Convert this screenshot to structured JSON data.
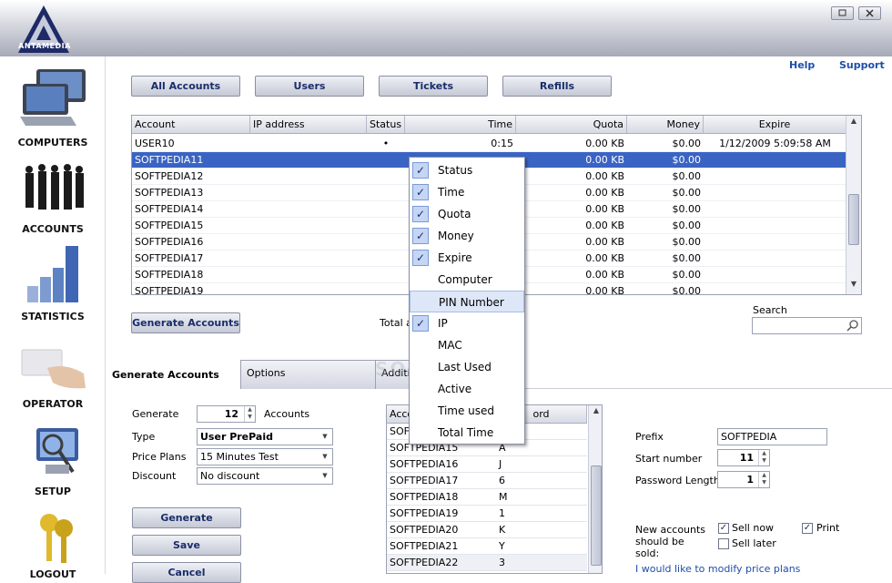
{
  "app": {
    "logo_text": "ANTAMEDIA"
  },
  "links": {
    "help": "Help",
    "support": "Support"
  },
  "sidebar": [
    {
      "name": "computers",
      "label": "COMPUTERS"
    },
    {
      "name": "accounts",
      "label": "ACCOUNTS"
    },
    {
      "name": "statistics",
      "label": "STATISTICS"
    },
    {
      "name": "operator",
      "label": "OPERATOR"
    },
    {
      "name": "setup",
      "label": "SETUP"
    },
    {
      "name": "logout",
      "label": "LOGOUT"
    }
  ],
  "top_tabs": [
    "All Accounts",
    "Users",
    "Tickets",
    "Refills"
  ],
  "grid": {
    "columns": [
      "Account",
      "IP address",
      "Status",
      "Time",
      "Quota",
      "Money",
      "Expire"
    ],
    "rows": [
      {
        "account": "USER10",
        "ip": "",
        "status": "•",
        "time": "0:15",
        "quota": "0.00 KB",
        "money": "$0.00",
        "expire": "1/12/2009 5:09:58 AM"
      },
      {
        "account": "SOFTPEDIA11",
        "ip": "",
        "status": "",
        "time": "",
        "quota": "0.00 KB",
        "money": "$0.00",
        "expire": ""
      },
      {
        "account": "SOFTPEDIA12",
        "ip": "",
        "status": "",
        "time": "",
        "quota": "0.00 KB",
        "money": "$0.00",
        "expire": ""
      },
      {
        "account": "SOFTPEDIA13",
        "ip": "",
        "status": "",
        "time": "",
        "quota": "0.00 KB",
        "money": "$0.00",
        "expire": ""
      },
      {
        "account": "SOFTPEDIA14",
        "ip": "",
        "status": "",
        "time": "",
        "quota": "0.00 KB",
        "money": "$0.00",
        "expire": ""
      },
      {
        "account": "SOFTPEDIA15",
        "ip": "",
        "status": "",
        "time": "",
        "quota": "0.00 KB",
        "money": "$0.00",
        "expire": ""
      },
      {
        "account": "SOFTPEDIA16",
        "ip": "",
        "status": "",
        "time": "",
        "quota": "0.00 KB",
        "money": "$0.00",
        "expire": ""
      },
      {
        "account": "SOFTPEDIA17",
        "ip": "",
        "status": "",
        "time": "",
        "quota": "0.00 KB",
        "money": "$0.00",
        "expire": ""
      },
      {
        "account": "SOFTPEDIA18",
        "ip": "",
        "status": "",
        "time": "",
        "quota": "0.00 KB",
        "money": "$0.00",
        "expire": ""
      },
      {
        "account": "SOFTPEDIA19",
        "ip": "",
        "status": "",
        "time": "",
        "quota": "0.00 KB",
        "money": "$0.00",
        "expire": ""
      }
    ]
  },
  "actions": {
    "generate_accounts": "Generate  Accounts",
    "total_label": "Total a",
    "search_label": "Search",
    "search_value": ""
  },
  "context_menu": [
    {
      "label": "Status",
      "checked": true
    },
    {
      "label": "Time",
      "checked": true
    },
    {
      "label": "Quota",
      "checked": true
    },
    {
      "label": "Money",
      "checked": true
    },
    {
      "label": "Expire",
      "checked": true
    },
    {
      "label": "Computer",
      "checked": false
    },
    {
      "label": "PIN Number",
      "checked": false,
      "highlight": true
    },
    {
      "label": "IP",
      "checked": true
    },
    {
      "label": "MAC",
      "checked": false
    },
    {
      "label": "Last Used",
      "checked": false
    },
    {
      "label": "Active",
      "checked": false
    },
    {
      "label": "Time used",
      "checked": false
    },
    {
      "label": "Total Time",
      "checked": false
    }
  ],
  "bottom_tabs": [
    "Generate  Accounts",
    "Options",
    "Additio"
  ],
  "watermark": "SOFTPEDIA",
  "form": {
    "generate_label": "Generate",
    "generate_value": "12",
    "accounts_label": "Accounts",
    "type_label": "Type",
    "type_value": "User PrePaid",
    "price_label": "Price Plans",
    "price_value": "15 Minutes Test",
    "discount_label": "Discount",
    "discount_value": "No discount",
    "generate_btn": "Generate",
    "save_btn": "Save",
    "cancel_btn": "Cancel"
  },
  "gen_grid": {
    "col1": "Acco",
    "col2": "ord",
    "rows": [
      {
        "account": "SOFT",
        "pin": ""
      },
      {
        "account": "SOFTPEDIA15",
        "pin": "A"
      },
      {
        "account": "SOFTPEDIA16",
        "pin": "J"
      },
      {
        "account": "SOFTPEDIA17",
        "pin": "6"
      },
      {
        "account": "SOFTPEDIA18",
        "pin": "M"
      },
      {
        "account": "SOFTPEDIA19",
        "pin": "1"
      },
      {
        "account": "SOFTPEDIA20",
        "pin": "K"
      },
      {
        "account": "SOFTPEDIA21",
        "pin": "Y"
      },
      {
        "account": "SOFTPEDIA22",
        "pin": "3"
      }
    ]
  },
  "right": {
    "prefix_label": "Prefix",
    "prefix_value": "SOFTPEDIA",
    "start_label": "Start number",
    "start_value": "11",
    "pwlen_label": "Password Length",
    "pwlen_value": "1",
    "sold_label": "New accounts should be sold:",
    "sell_now": "Sell now",
    "sell_later": "Sell later",
    "print": "Print",
    "modify_link": "I would like to modify price plans"
  },
  "colors": {
    "accent": "#3a64c4",
    "link": "#1f4ea8",
    "button_text": "#1a2d6b"
  }
}
